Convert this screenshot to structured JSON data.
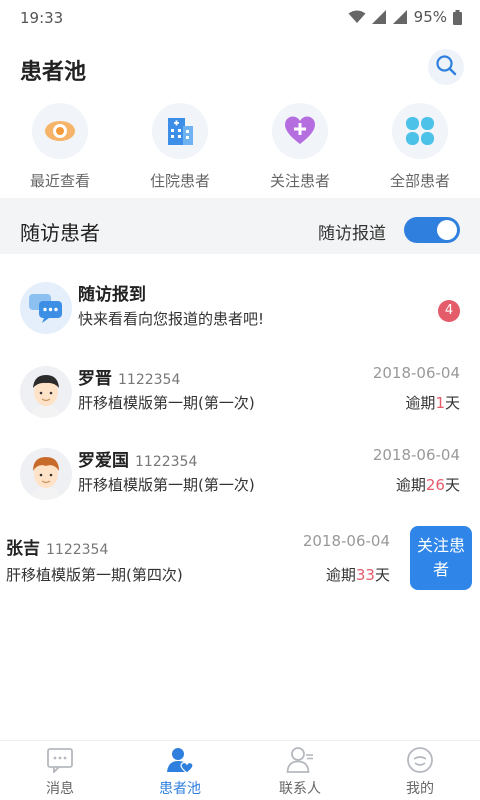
{
  "status_bar": {
    "time": "19:33",
    "battery": "95%"
  },
  "header": {
    "title": "患者池"
  },
  "quick_actions": [
    {
      "label": "最近查看",
      "icon": "eye-icon"
    },
    {
      "label": "住院患者",
      "icon": "hospital-icon"
    },
    {
      "label": "关注患者",
      "icon": "heart-plus-icon"
    },
    {
      "label": "全部患者",
      "icon": "clover-icon"
    }
  ],
  "follow_section": {
    "title": "随访患者",
    "report_label": "随访报道",
    "report_toggle_on": true
  },
  "checkin": {
    "title": "随访报到",
    "subtitle": "快来看看向您报道的患者吧!",
    "badge": "4"
  },
  "patients": [
    {
      "name": "罗晋",
      "id": "1122354",
      "plan": "肝移植模版第一期(第一次)",
      "date": "2018-06-04",
      "overdue_prefix": "逾期",
      "overdue_days": "1",
      "overdue_suffix": "天"
    },
    {
      "name": "罗爱国",
      "id": "1122354",
      "plan": "肝移植模版第一期(第一次)",
      "date": "2018-06-04",
      "overdue_prefix": "逾期",
      "overdue_days": "26",
      "overdue_suffix": "天"
    },
    {
      "name": "张吉",
      "id": "1122354",
      "plan": "肝移植模版第一期(第四次)",
      "date": "2018-06-04",
      "overdue_prefix": "逾期",
      "overdue_days": "33",
      "overdue_suffix": "天",
      "swipe_action": "关注患者"
    }
  ],
  "tabbar": [
    {
      "label": "消息",
      "icon": "message-icon",
      "active": false
    },
    {
      "label": "患者池",
      "icon": "patients-icon",
      "active": true
    },
    {
      "label": "联系人",
      "icon": "contacts-icon",
      "active": false
    },
    {
      "label": "我的",
      "icon": "profile-icon",
      "active": false
    }
  ],
  "colors": {
    "accent": "#2f80de",
    "badge": "#e45b6a",
    "overdue_number": "#e45b6a"
  }
}
